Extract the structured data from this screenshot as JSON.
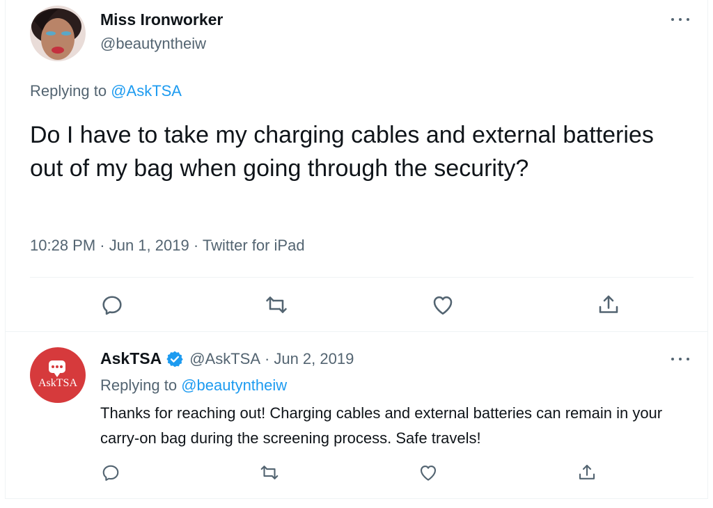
{
  "main_tweet": {
    "author_name": "Miss Ironworker",
    "author_handle": "@beautyntheiw",
    "avatar_icon": "user-avatar-photo",
    "replying_prefix": "Replying to ",
    "replying_to": "@AskTSA",
    "text": "Do I have to take my charging cables and external batteries out of my bag when going through the security?",
    "meta": "10:28 PM · Jun 1, 2019 · Twitter for iPad",
    "actions": [
      "reply-icon",
      "retweet-icon",
      "like-icon",
      "share-icon"
    ],
    "more_icon": "more-options-icon"
  },
  "reply_tweet": {
    "author_name": "AskTSA",
    "verified_icon": "verified-badge-icon",
    "author_handle": "@AskTSA",
    "dot": "·",
    "date": "Jun 2, 2019",
    "avatar_label": "AskTSA",
    "replying_prefix": "Replying to ",
    "replying_to": "@beautyntheiw",
    "text": "Thanks for reaching out! Charging cables and external batteries can remain in your carry-on bag during the screening process. Safe travels!",
    "actions": [
      "reply-icon",
      "retweet-icon",
      "like-icon",
      "share-icon"
    ],
    "more_icon": "more-options-icon"
  },
  "colors": {
    "text_primary": "#0f1419",
    "text_secondary": "#536471",
    "link": "#1d9bf0",
    "divider": "#eff3f4",
    "asktsa_brand": "#d63a3c",
    "verified": "#1d9bf0"
  }
}
